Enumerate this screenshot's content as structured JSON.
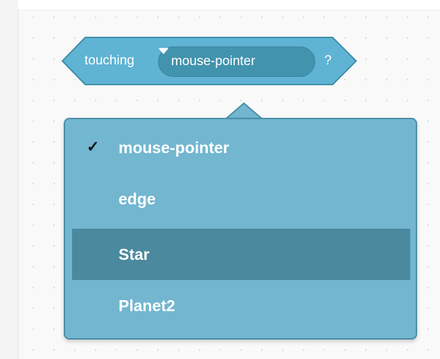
{
  "block": {
    "label": "touching",
    "dropdown_value": "mouse-pointer",
    "dropdown_icon": "caret-down-icon",
    "suffix": "?",
    "color": "#5cb1d6"
  },
  "menu": {
    "selected_mark": "✓",
    "items": [
      {
        "label": "mouse-pointer",
        "checked": true
      },
      {
        "label": "edge",
        "checked": false
      },
      {
        "label": "Star",
        "checked": false,
        "highlighted": true
      },
      {
        "label": "Planet2",
        "checked": false
      }
    ],
    "background": "#72b6d0",
    "highlight": "#4a899e"
  }
}
